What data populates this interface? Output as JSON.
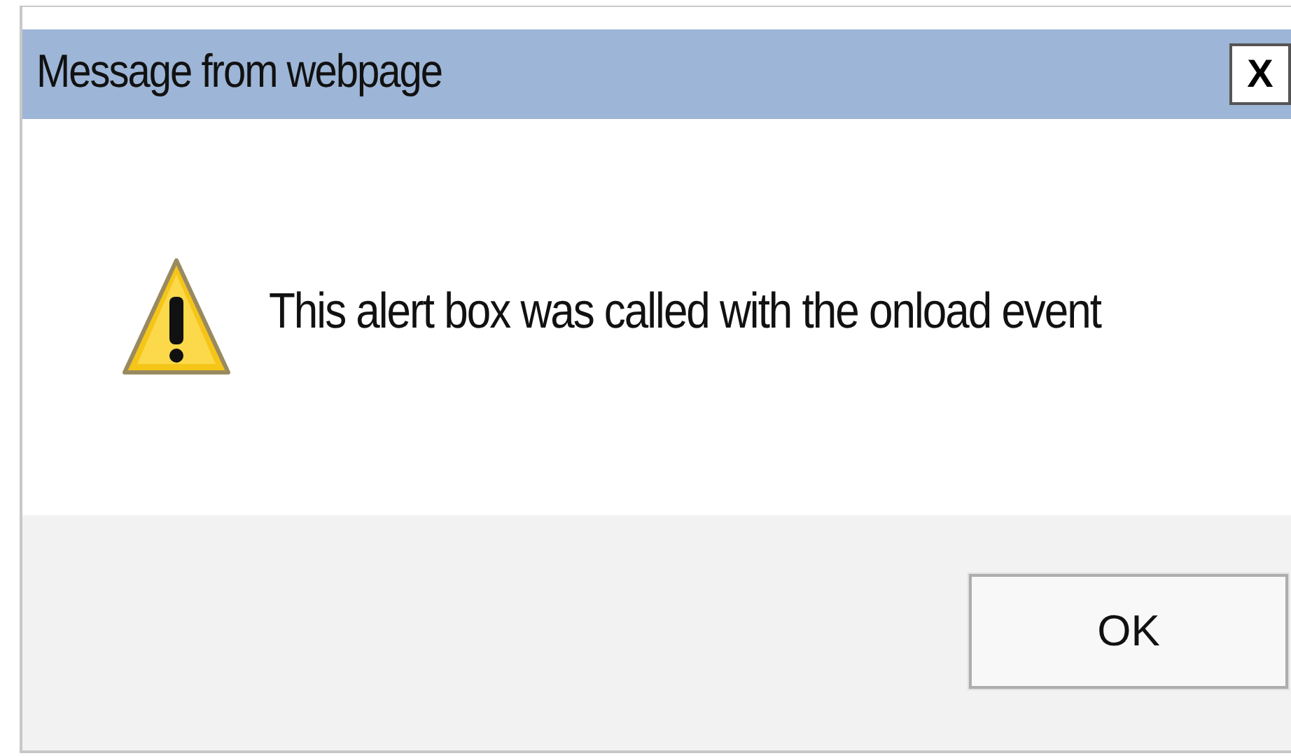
{
  "window": {
    "title": "Message from webpage",
    "close": "X"
  },
  "message": "This alert box was called with the onload event",
  "buttons": [
    "OK"
  ]
}
